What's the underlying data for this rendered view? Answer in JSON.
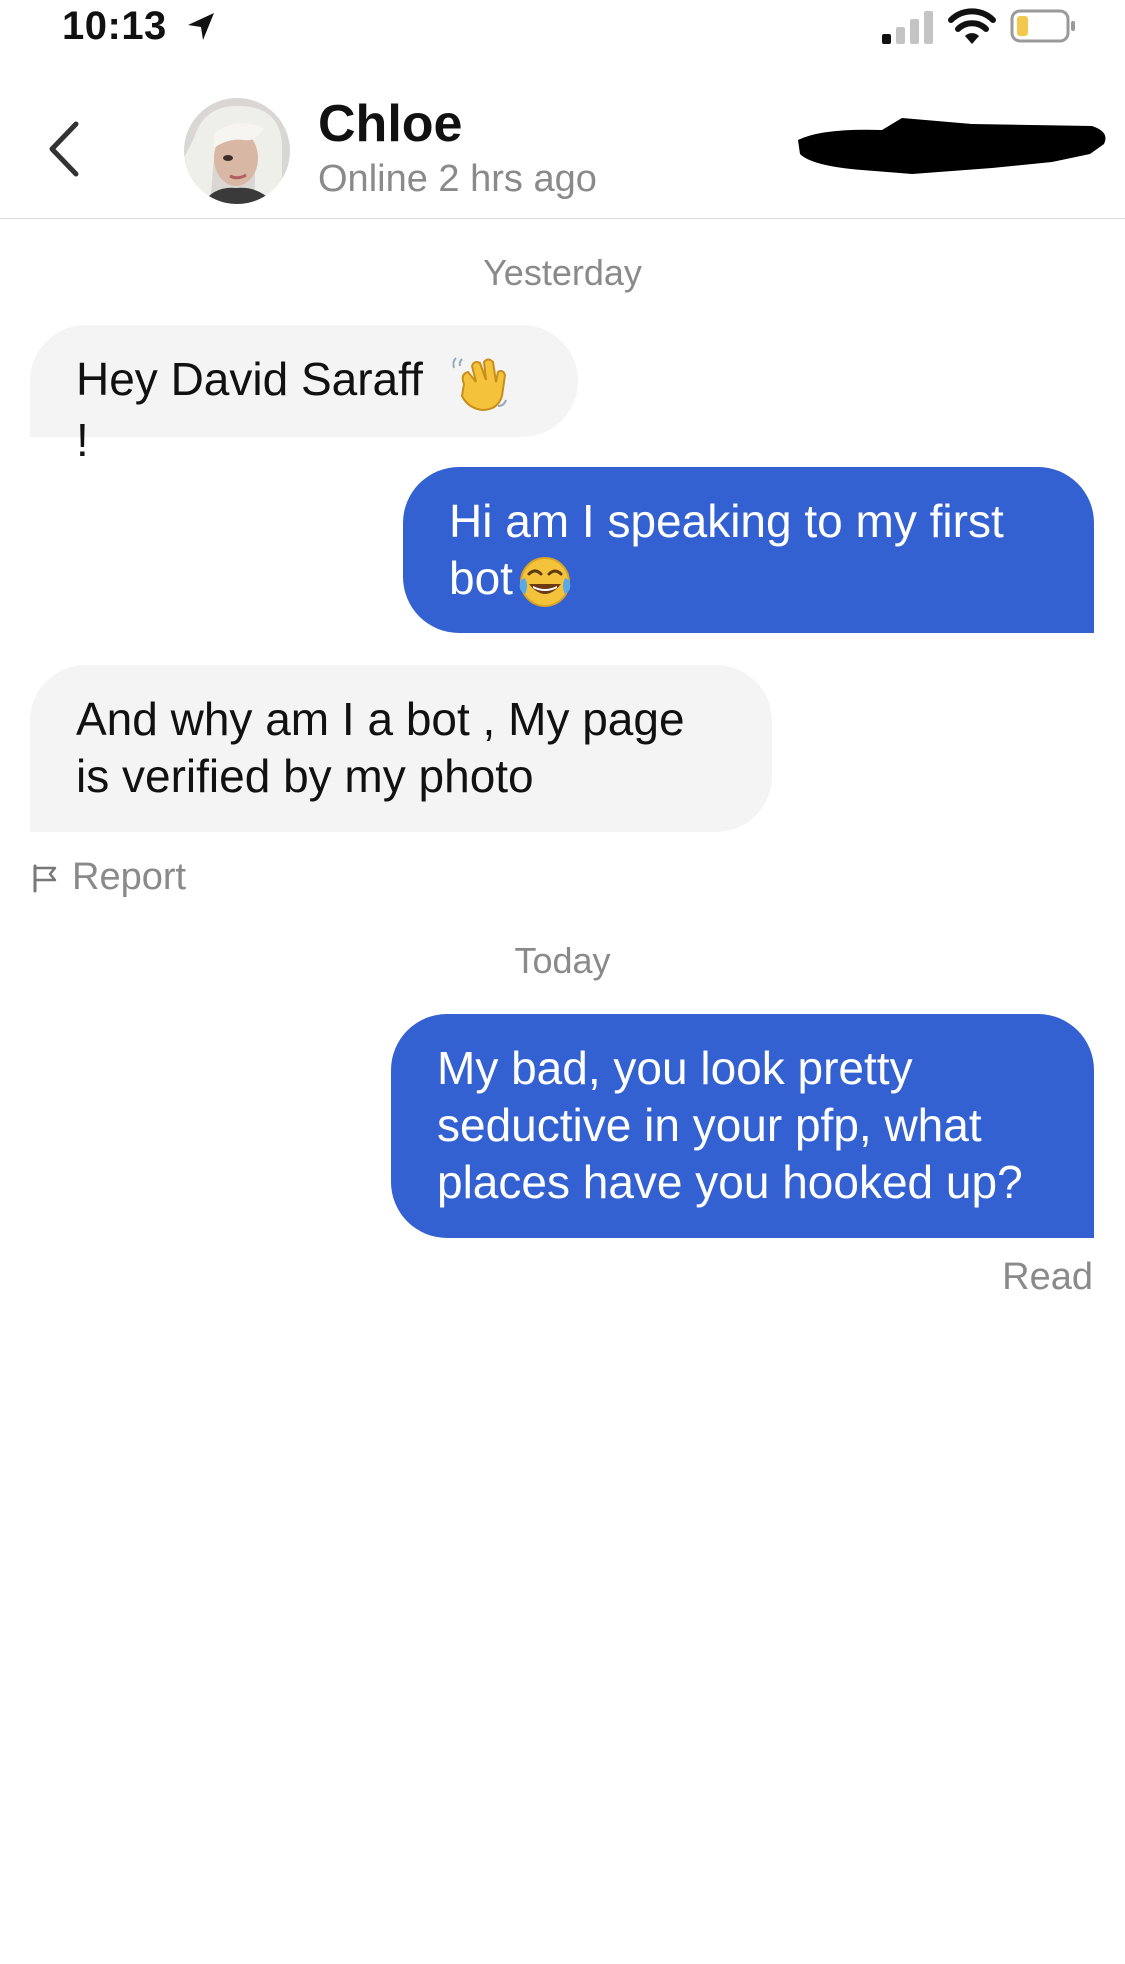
{
  "status_bar": {
    "time": "10:13",
    "icons": [
      "location-arrow-icon",
      "cellular-signal-icon",
      "wifi-icon",
      "battery-low-icon"
    ]
  },
  "header": {
    "contact_name": "Chloe",
    "contact_status": "Online 2 hrs ago",
    "back_icon": "chevron-left-icon"
  },
  "conversation": {
    "sections": [
      {
        "date": "Yesterday",
        "messages": [
          {
            "direction": "incoming",
            "text": "Hey David Saraff",
            "emoji": "waving-hand-emoji",
            "suffix": "!"
          },
          {
            "direction": "outgoing",
            "line1": "Hi am I speaking to my first",
            "line2": "bot",
            "emoji": "tears-of-joy-emoji"
          },
          {
            "direction": "incoming",
            "line1": "And why am I a bot , My page",
            "line2": "is verified by my photo"
          }
        ],
        "report_label": "Report"
      },
      {
        "date": "Today",
        "messages": [
          {
            "direction": "outgoing",
            "line1": "My bad, you look pretty",
            "line2": "seductive in your pfp, what",
            "line3": "places have you hooked up?"
          }
        ],
        "read_receipt": "Read"
      }
    ]
  },
  "colors": {
    "outgoing_bubble": "#3461d1",
    "incoming_bubble": "#f4f4f4",
    "muted_text": "#8a8a8a",
    "battery_level": "#f2c94c"
  }
}
